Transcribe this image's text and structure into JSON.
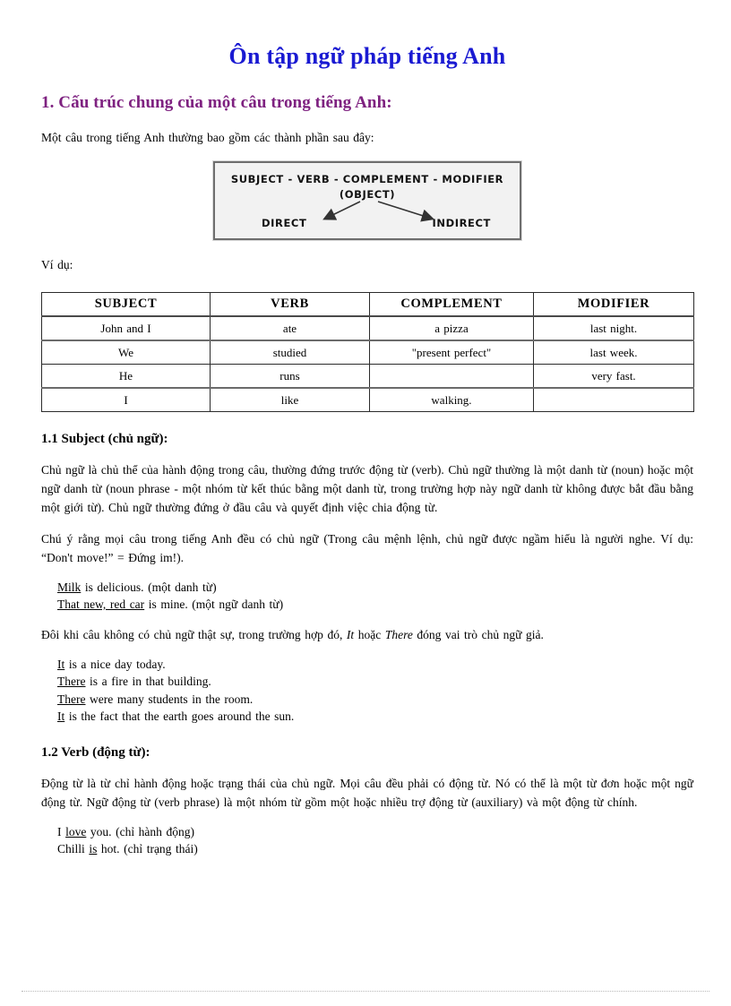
{
  "document": {
    "title": "Ôn tập ngữ pháp tiếng Anh",
    "section1_heading": "1. Cấu trúc chung của một câu trong tiếng Anh:",
    "intro_paragraph": "Một câu trong tiếng Anh thường bao gồm các thành phần sau đây:",
    "example_label": "Ví dụ:"
  },
  "diagram": {
    "line1": "SUBJECT - VERB - COMPLEMENT - MODIFIER",
    "line2": "(OBJECT)",
    "left_label": "DIRECT",
    "right_label": "INDIRECT",
    "border_color": "#6e6e6e",
    "background_color": "#f2f2f2"
  },
  "table": {
    "headers": [
      "SUBJECT",
      "VERB",
      "COMPLEMENT",
      "MODIFIER"
    ],
    "rows": [
      [
        "John and I",
        "ate",
        "a pizza",
        "last night."
      ],
      [
        "We",
        "studied",
        "\"present  perfect\"",
        "last week."
      ],
      [
        "He",
        "runs",
        "",
        "very fast."
      ],
      [
        "I",
        "like",
        "walking.",
        ""
      ]
    ]
  },
  "subject_section": {
    "heading": "1.1 Subject (chủ ngữ):",
    "paragraph1": "Chủ ngữ là chủ thể của hành động trong câu, thường đứng trước động từ (verb). Chủ ngữ thường là một danh từ (noun) hoặc một ngữ danh từ (noun phrase - một nhóm từ kết thúc bằng một danh từ, trong trường hợp này ngữ danh từ không được bắt đầu bằng một giới từ). Chủ ngữ thường đứng ở đầu câu và quyết định việc chia động từ.",
    "paragraph2": "Chú ý rằng mọi câu trong tiếng Anh đều có chủ ngữ (Trong câu mệnh lệnh, chủ ngữ được ngầm hiểu là người nghe. Ví dụ: “Don't move!” = Đứng im!).",
    "examples1": [
      {
        "underlined": "Milk",
        "rest": " is delicious.  (một danh từ)"
      },
      {
        "underlined": "That new, red car",
        "rest": " is mine.  (một ngữ danh từ)"
      }
    ],
    "paragraph3_before": "Đôi khi câu không có chủ ngữ thật sự, trong trường hợp đó, ",
    "paragraph3_italic1": "It",
    "paragraph3_mid": " hoặc ",
    "paragraph3_italic2": "There",
    "paragraph3_after": " đóng vai trò chủ ngữ giả.",
    "examples2": [
      {
        "underlined": "It",
        "rest": " is a nice day today."
      },
      {
        "underlined": "There",
        "rest": " is a fire in that building."
      },
      {
        "underlined": "There",
        "rest": " were many students in the room."
      },
      {
        "underlined": "It",
        "rest": " is the fact that the earth goes around the sun."
      }
    ]
  },
  "verb_section": {
    "heading": "1.2 Verb (động từ):",
    "paragraph1": "Động từ là từ chỉ hành động hoặc trạng thái của chủ ngữ. Mọi câu đều phải có động từ. Nó có thể là một từ đơn hoặc một ngữ động từ. Ngữ động từ (verb phrase) là một nhóm từ gồm một hoặc nhiều trợ động từ (auxiliary) và một động từ chính.",
    "examples": [
      {
        "before": "I ",
        "underlined": "love",
        "rest": " you. (chỉ hành động)"
      },
      {
        "before": "Chilli  ",
        "underlined": "is",
        "rest": " hot. (chỉ trạng thái)"
      }
    ]
  },
  "colors": {
    "title": "#1a1ad2",
    "heading": "#7e2180",
    "body": "#000000"
  }
}
